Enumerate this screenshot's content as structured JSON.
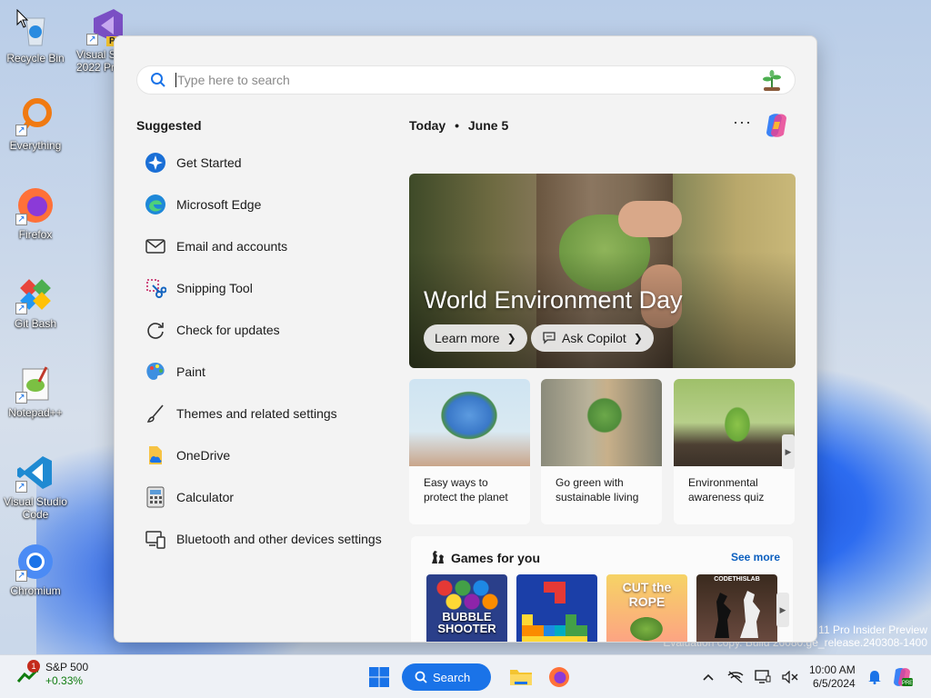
{
  "desktop": {
    "icons": [
      {
        "label": "Recycle Bin"
      },
      {
        "label": "Visual S... 2022 Pre..."
      },
      {
        "label": "Everything"
      },
      {
        "label": "Firefox"
      },
      {
        "label": "Git Bash"
      },
      {
        "label": "Notepad++"
      },
      {
        "label": "Visual Studio Code"
      },
      {
        "label": "Chromium"
      }
    ],
    "vs_badge": "PI",
    "watermark_line1": "11 Pro Insider Preview",
    "watermark_line2": "Evaluation copy. Build 26080.ge_release.240308-1400"
  },
  "start": {
    "search": {
      "placeholder": "Type here to search"
    },
    "suggested_title": "Suggested",
    "suggested": [
      {
        "label": "Get Started",
        "icon": "get-started-icon"
      },
      {
        "label": "Microsoft Edge",
        "icon": "edge-icon"
      },
      {
        "label": "Email and accounts",
        "icon": "mail-icon"
      },
      {
        "label": "Snipping Tool",
        "icon": "scissors-icon"
      },
      {
        "label": "Check for updates",
        "icon": "refresh-icon"
      },
      {
        "label": "Paint",
        "icon": "paint-icon"
      },
      {
        "label": "Themes and related settings",
        "icon": "brush-icon"
      },
      {
        "label": "OneDrive",
        "icon": "onedrive-icon"
      },
      {
        "label": "Calculator",
        "icon": "calculator-icon"
      },
      {
        "label": "Bluetooth and other devices settings",
        "icon": "devices-icon"
      }
    ],
    "today": {
      "label": "Today",
      "separator": "•",
      "date": "June 5"
    },
    "more": "···",
    "hero": {
      "title": "World Environment Day",
      "learn_more": "Learn more",
      "ask_copilot": "Ask Copilot"
    },
    "cards": [
      {
        "caption": "Easy ways to protect the planet"
      },
      {
        "caption": "Go green with sustainable living"
      },
      {
        "caption": "Environmental awareness quiz"
      }
    ],
    "games": {
      "title": "Games for you",
      "see_more": "See more",
      "tiles": [
        "BUBBLE SHOOTER",
        "",
        "CUT the ROPE",
        "CODETHISLAB"
      ]
    }
  },
  "taskbar": {
    "widget": {
      "name": "S&P 500",
      "change": "+0.33%",
      "badge": "1"
    },
    "search_label": "Search",
    "clock": {
      "time": "10:00 AM",
      "date": "6/5/2024"
    }
  },
  "colors": {
    "accent": "#1a73e8",
    "positive": "#107c10",
    "link": "#0b5fbf",
    "badge": "#c42b1c"
  }
}
